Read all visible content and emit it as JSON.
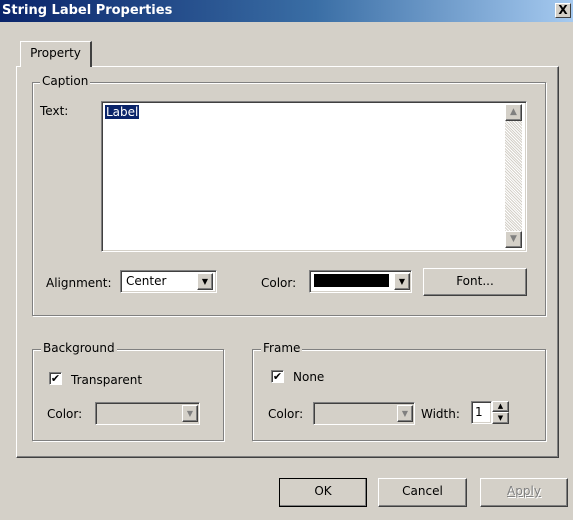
{
  "window": {
    "title": "String Label Properties",
    "close_glyph": "X"
  },
  "tabs": [
    {
      "label": "Property",
      "active": true
    }
  ],
  "caption": {
    "legend": "Caption",
    "text_label": "Text:",
    "text_value": "Label",
    "alignment_label": "Alignment:",
    "alignment_value": "Center",
    "color_label": "Color:",
    "color_value": "#000000",
    "font_button": "Font..."
  },
  "background": {
    "legend": "Background",
    "transparent_label": "Transparent",
    "transparent_checked": true,
    "color_label": "Color:"
  },
  "frame": {
    "legend": "Frame",
    "none_label": "None",
    "none_checked": true,
    "color_label": "Color:",
    "width_label": "Width:",
    "width_value": "1"
  },
  "buttons": {
    "ok": "OK",
    "cancel": "Cancel",
    "apply": "Apply"
  },
  "icons": {
    "check": "✔",
    "dropdown": "▼",
    "scroll_up": "▲",
    "scroll_down": "▼",
    "spin_up": "▲",
    "spin_down": "▼"
  }
}
